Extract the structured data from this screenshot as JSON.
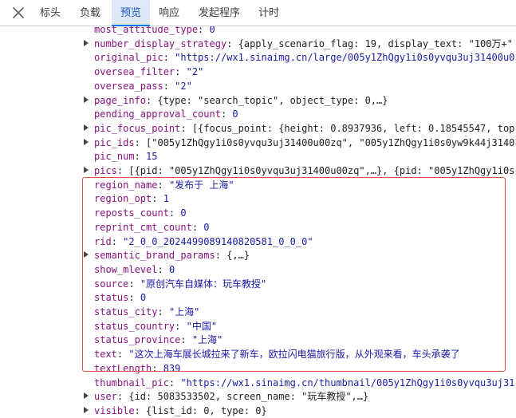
{
  "tabs": [
    {
      "label": "标头"
    },
    {
      "label": "负载"
    },
    {
      "label": "预览"
    },
    {
      "label": "响应"
    },
    {
      "label": "发起程序"
    },
    {
      "label": "计时"
    }
  ],
  "active_tab": "预览",
  "rows": [
    {
      "expandable": false,
      "key": "most_attitude_type",
      "value": "0",
      "vtype": "num"
    },
    {
      "expandable": true,
      "key": "number_display_strategy",
      "value": "{apply_scenario_flag: 19, display_text: \"100万+\"",
      "vtype": "plain"
    },
    {
      "expandable": false,
      "key": "original_pic",
      "value": "\"https://wx1.sinaimg.cn/large/005y1ZhQgy1i0s0yvqu3uj31400u0",
      "vtype": "str"
    },
    {
      "expandable": false,
      "key": "oversea_filter",
      "value": "\"2\"",
      "vtype": "str"
    },
    {
      "expandable": false,
      "key": "oversea_pass",
      "value": "\"2\"",
      "vtype": "str"
    },
    {
      "expandable": true,
      "key": "page_info",
      "value": "{type: \"search_topic\", object_type: 0,…}",
      "vtype": "plain"
    },
    {
      "expandable": false,
      "key": "pending_approval_count",
      "value": "0",
      "vtype": "num"
    },
    {
      "expandable": true,
      "key": "pic_focus_point",
      "value": "[{focus_point: {height: 0.8937936, left: 0.18545547, top",
      "vtype": "plain"
    },
    {
      "expandable": true,
      "key": "pic_ids",
      "value": "[\"005y1ZhQgy1i0s0yvqu3uj31400u00zq\", \"005y1ZhQgy1i0s0yw9k44j3140",
      "vtype": "plain"
    },
    {
      "expandable": false,
      "key": "pic_num",
      "value": "15",
      "vtype": "num"
    },
    {
      "expandable": true,
      "key": "pics",
      "value": "[{pid: \"005y1ZhQgy1i0s0yvqu3uj31400u00zq\",…}, {pid: \"005y1ZhQgy1i0s",
      "vtype": "plain"
    },
    {
      "expandable": false,
      "key": "region_name",
      "value": "\"发布于 上海\"",
      "vtype": "str"
    },
    {
      "expandable": false,
      "key": "region_opt",
      "value": "1",
      "vtype": "num"
    },
    {
      "expandable": false,
      "key": "reposts_count",
      "value": "0",
      "vtype": "num"
    },
    {
      "expandable": false,
      "key": "reprint_cmt_count",
      "value": "0",
      "vtype": "num"
    },
    {
      "expandable": false,
      "key": "rid",
      "value": "\"2_0_0_2024499089140820581_0_0_0\"",
      "vtype": "str"
    },
    {
      "expandable": true,
      "key": "semantic_brand_params",
      "value": "{,…}",
      "vtype": "plain"
    },
    {
      "expandable": false,
      "key": "show_mlevel",
      "value": "0",
      "vtype": "num"
    },
    {
      "expandable": false,
      "key": "source",
      "value": "\"原创汽车自媒体：玩车教授\"",
      "vtype": "str"
    },
    {
      "expandable": false,
      "key": "status",
      "value": "0",
      "vtype": "num"
    },
    {
      "expandable": false,
      "key": "status_city",
      "value": "\"上海\"",
      "vtype": "str"
    },
    {
      "expandable": false,
      "key": "status_country",
      "value": "\"中国\"",
      "vtype": "str"
    },
    {
      "expandable": false,
      "key": "status_province",
      "value": "\"上海\"",
      "vtype": "str"
    },
    {
      "expandable": false,
      "key": "text",
      "value": "\"这次上海车展长城拉来了新车，欧拉闪电猫旅行版，从外观来看，车头承袭了",
      "vtype": "str"
    },
    {
      "expandable": false,
      "key": "textLength",
      "value": "839",
      "vtype": "num"
    },
    {
      "expandable": false,
      "key": "thumbnail_pic",
      "value": "\"https://wx1.sinaimg.cn/thumbnail/005y1ZhQgy1i0s0yvqu3uj31",
      "vtype": "str"
    },
    {
      "expandable": true,
      "key": "user",
      "value": "{id: 5083533502, screen_name: \"玩车教授\",…}",
      "vtype": "plain"
    },
    {
      "expandable": true,
      "key": "visible",
      "value": "{list_id: 0, type: 0}",
      "vtype": "plain"
    }
  ],
  "colors": {
    "key": "#881280",
    "string": "#1a1aa6",
    "highlight_border": "#e0504a",
    "active_tab_bg": "#dfe8f6",
    "active_tab_text": "#1a56c5"
  }
}
